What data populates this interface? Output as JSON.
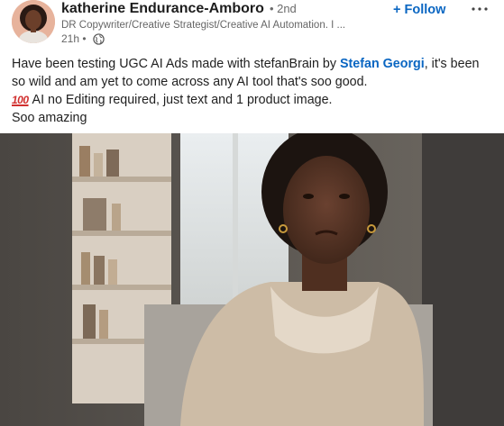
{
  "author": {
    "name": "katherine Endurance-Amboro",
    "degree": "• 2nd",
    "headline": "DR Copywriter/Creative Strategist/Creative AI Automation. I ...",
    "time": "21h •"
  },
  "follow_label": "+ Follow",
  "more_label": "•••",
  "post": {
    "line1_pre": "Have been testing UGC AI Ads made with stefanBrain by ",
    "mention": "Stefan Georgi",
    "line1_post": ", it's been",
    "line2": "so wild and am yet to come across any AI tool that's soo good.",
    "emoji": "100",
    "line3": "AI no Editing required, just text and 1 product image.",
    "line4": "Soo amazing"
  },
  "colors": {
    "link": "#0a66c2",
    "text": "#1f1f1f",
    "meta": "#666666"
  },
  "icons": {
    "globe": "globe-icon",
    "more": "ellipsis-icon",
    "hundred": "hundred-points-emoji"
  }
}
